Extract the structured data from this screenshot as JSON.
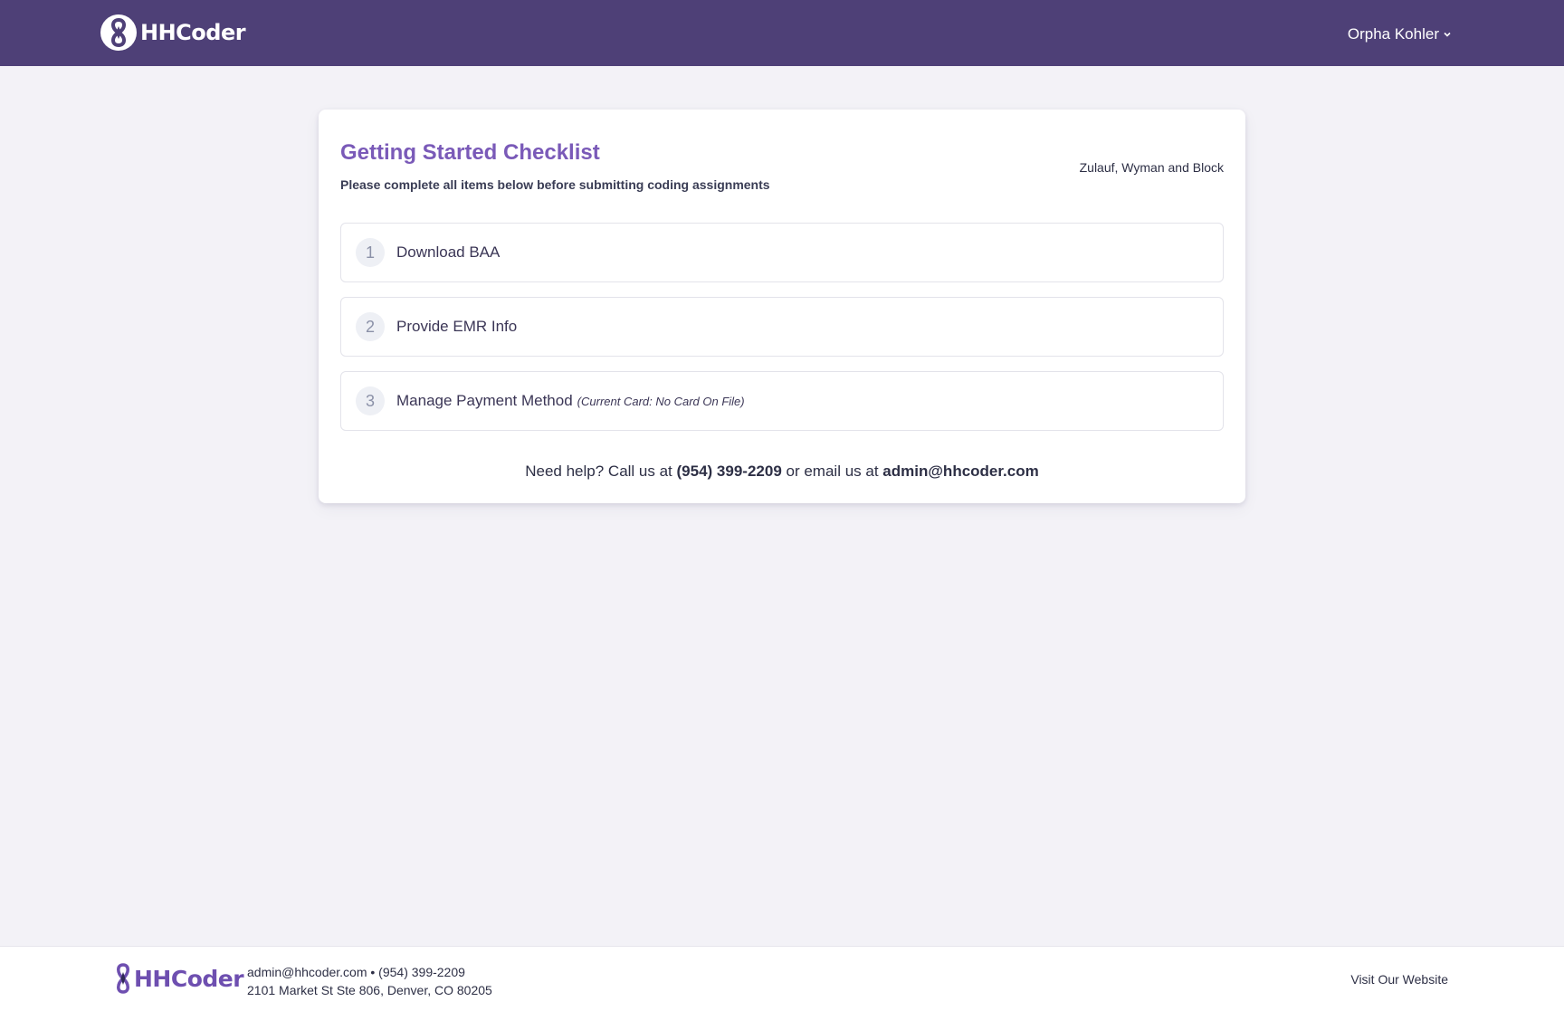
{
  "header": {
    "brand": "HHCoder",
    "user_name": "Orpha Kohler"
  },
  "checklist": {
    "title": "Getting Started Checklist",
    "subtitle": "Please complete all items below before submitting coding assignments",
    "organization": "Zulauf, Wyman and Block",
    "items": [
      {
        "number": "1",
        "label": "Download BAA",
        "note": ""
      },
      {
        "number": "2",
        "label": "Provide EMR Info",
        "note": ""
      },
      {
        "number": "3",
        "label": "Manage Payment Method",
        "note": "(Current Card: No Card On File)"
      }
    ]
  },
  "help": {
    "prefix": "Need help? Call us at",
    "phone": "(954) 399-2209",
    "middle": "or email us at",
    "email": "admin@hhcoder.com"
  },
  "footer": {
    "brand": "HHCoder",
    "contact_line": "admin@hhcoder.com • (954) 399-2209",
    "address": "2101 Market St Ste 806, Denver, CO 80205",
    "website_link": "Visit Our Website"
  },
  "colors": {
    "header_bg": "#4e4077",
    "accent": "#7a5ab8",
    "page_bg": "#f3f2f7"
  }
}
